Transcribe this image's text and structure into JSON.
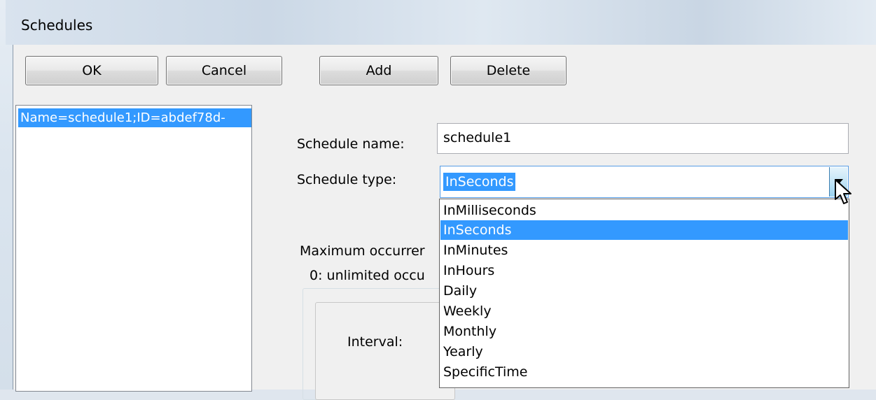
{
  "window": {
    "title": "Schedules"
  },
  "toolbar": {
    "ok_label": "OK",
    "cancel_label": "Cancel",
    "add_label": "Add",
    "delete_label": "Delete"
  },
  "schedule_list": {
    "items": [
      {
        "label": "Name=schedule1;ID=abdef78d-",
        "selected": true
      }
    ]
  },
  "form": {
    "name_label": "Schedule name:",
    "name_value": "schedule1",
    "type_label": "Schedule type:",
    "type_value": "InSeconds",
    "max_occurrences_label": "Maximum occurrer",
    "unlimited_label": "0: unlimited occu",
    "interval_label": "Interval:"
  },
  "type_dropdown": {
    "expanded": true,
    "selected": "InSeconds",
    "options": [
      "InMilliseconds",
      "InSeconds",
      "InMinutes",
      "InHours",
      "Daily",
      "Weekly",
      "Monthly",
      "Yearly",
      "SpecificTime"
    ]
  },
  "colors": {
    "selection": "#3399ff",
    "selection_text": "#ffffff"
  }
}
